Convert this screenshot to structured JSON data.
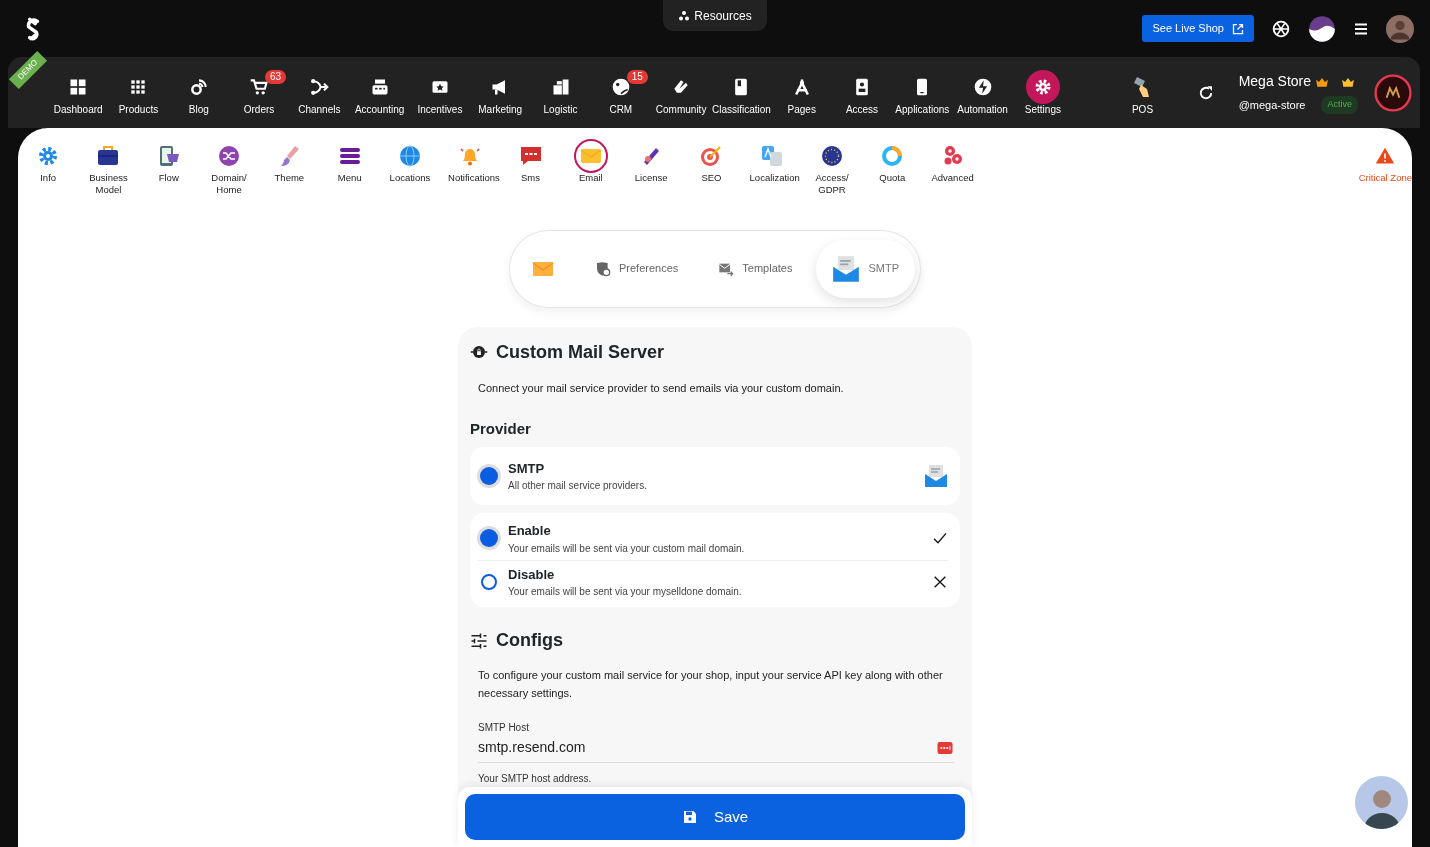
{
  "top_bar": {
    "resources": "Resources",
    "live_shop": "See Live Shop"
  },
  "demo_ribbon": "DEMO",
  "main_nav": [
    {
      "label": "Dashboard",
      "selected": false
    },
    {
      "label": "Products",
      "selected": false
    },
    {
      "label": "Blog",
      "selected": false
    },
    {
      "label": "Orders",
      "selected": false,
      "badge": "63"
    },
    {
      "label": "Channels",
      "selected": false
    },
    {
      "label": "Accounting",
      "selected": false
    },
    {
      "label": "Incentives",
      "selected": false
    },
    {
      "label": "Marketing",
      "selected": false
    },
    {
      "label": "Logistic",
      "selected": false
    },
    {
      "label": "CRM",
      "selected": false,
      "badge": "15"
    },
    {
      "label": "Community",
      "selected": false
    },
    {
      "label": "Classification",
      "selected": false
    },
    {
      "label": "Pages",
      "selected": false
    },
    {
      "label": "Access",
      "selected": false
    },
    {
      "label": "Applications",
      "selected": false
    },
    {
      "label": "Automation",
      "selected": false
    },
    {
      "label": "Settings",
      "selected": true
    }
  ],
  "store": {
    "pos": "POS",
    "name": "Mega Store",
    "handle": "@mega-store",
    "status": "Active"
  },
  "sub_nav": [
    {
      "label": "Info",
      "selected": false
    },
    {
      "label": "Business Model",
      "selected": false
    },
    {
      "label": "Flow",
      "selected": false
    },
    {
      "label": "Domain/ Home",
      "selected": false
    },
    {
      "label": "Theme",
      "selected": false
    },
    {
      "label": "Menu",
      "selected": false
    },
    {
      "label": "Locations",
      "selected": false
    },
    {
      "label": "Notifications",
      "selected": false
    },
    {
      "label": "Sms",
      "selected": false
    },
    {
      "label": "Email",
      "selected": true
    },
    {
      "label": "License",
      "selected": false
    },
    {
      "label": "SEO",
      "selected": false
    },
    {
      "label": "Localization",
      "selected": false
    },
    {
      "label": "Access/ GDPR",
      "selected": false
    },
    {
      "label": "Quota",
      "selected": false
    },
    {
      "label": "Advanced",
      "selected": false
    }
  ],
  "critical_zone": "Critical Zone",
  "email_tabs": [
    {
      "selected": false
    },
    {
      "label": "Preferences",
      "selected": false
    },
    {
      "label": "Templates",
      "selected": false
    },
    {
      "label": "SMTP",
      "selected": true
    }
  ],
  "custom_mail": {
    "title": "Custom Mail Server",
    "description": "Connect your mail service provider to send emails via your custom domain."
  },
  "provider": {
    "title": "Provider",
    "options": [
      {
        "title": "SMTP",
        "description": "All other mail service providers.",
        "selected": true
      }
    ]
  },
  "mode_options": [
    {
      "kind": "check",
      "title": "Enable",
      "description": "Your emails will be sent via your custom mail domain.",
      "selected": true
    },
    {
      "kind": "cross",
      "title": "Disable",
      "description": "Your emails will be sent via your myselldone domain.",
      "selected": false
    }
  ],
  "configs": {
    "title": "Configs",
    "description": "To configure your custom mail service for your shop, input your service API key along with other necessary settings.",
    "field": {
      "label": "SMTP Host",
      "value": "smtp.resend.com",
      "hint": "Your SMTP host address."
    }
  },
  "save": "Save"
}
